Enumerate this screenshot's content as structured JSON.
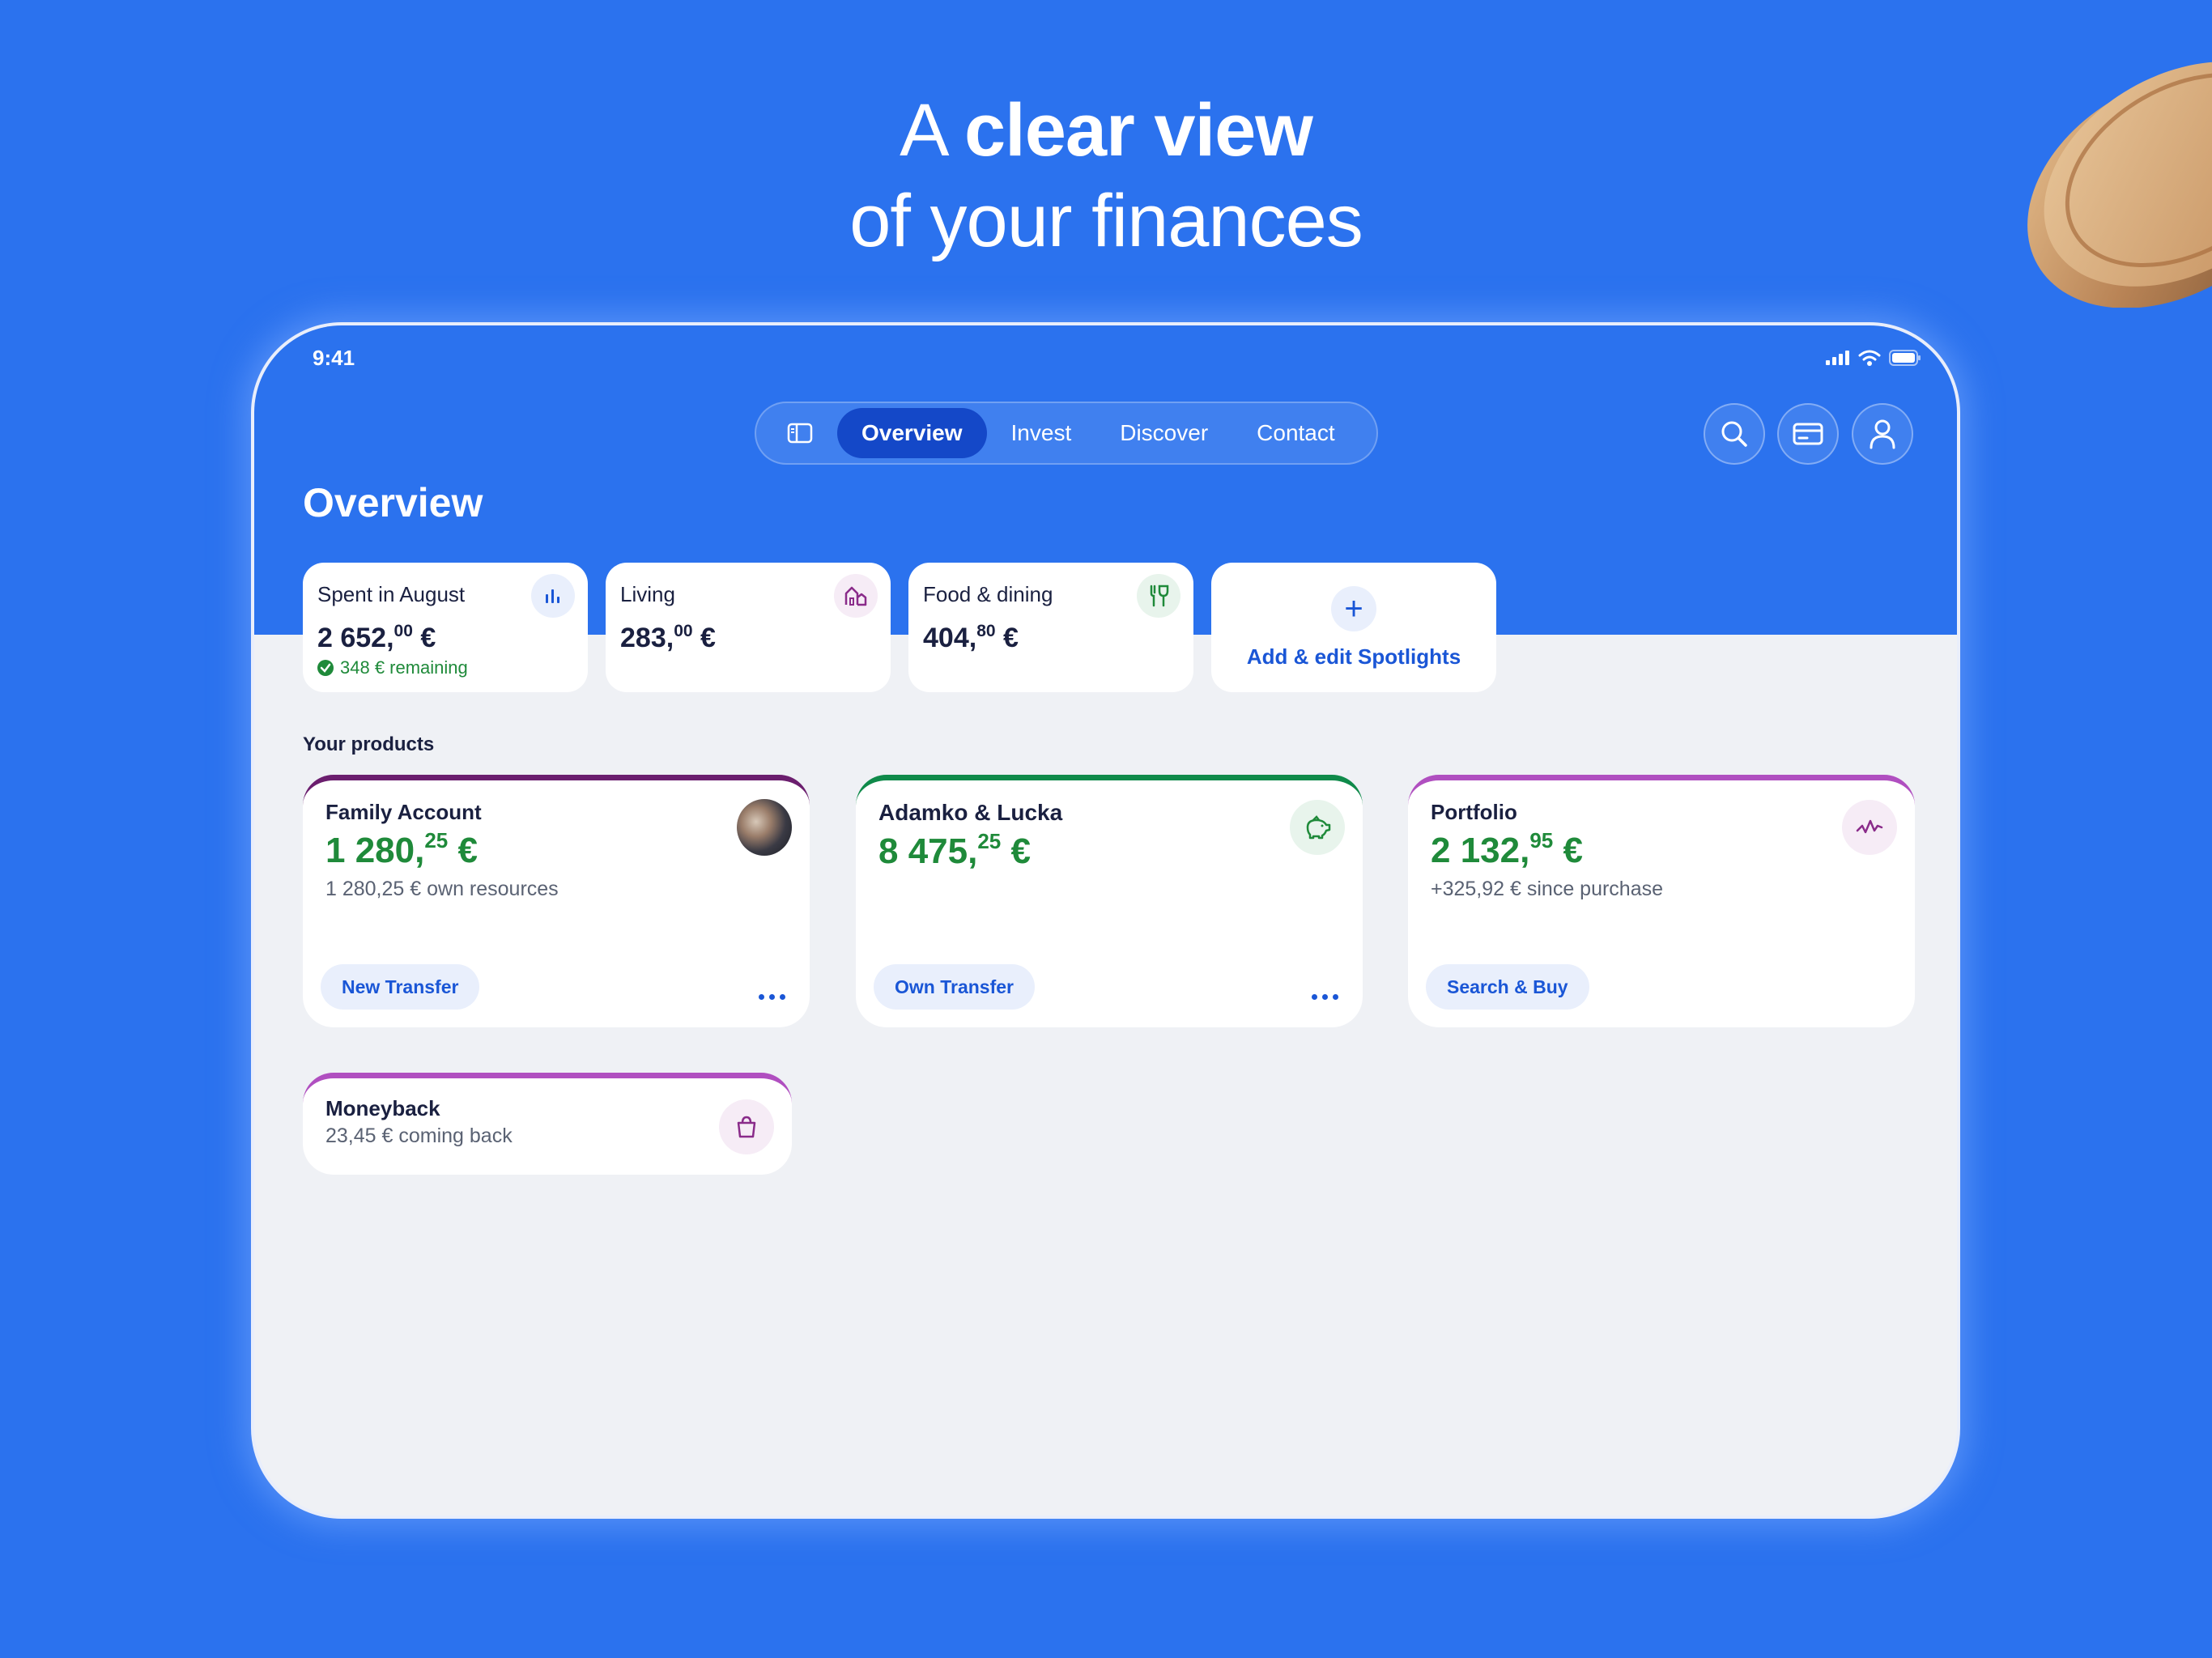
{
  "headline": {
    "line1_prefix": "A ",
    "line1_bold": "clear view",
    "line2": "of your finances"
  },
  "status_bar": {
    "time": "9:41"
  },
  "nav": {
    "tabs": [
      {
        "label": "Overview",
        "active": true
      },
      {
        "label": "Invest",
        "active": false
      },
      {
        "label": "Discover",
        "active": false
      },
      {
        "label": "Contact",
        "active": false
      }
    ]
  },
  "page_title": "Overview",
  "spotlights": [
    {
      "label": "Spent in August",
      "value_int": "2 652,",
      "value_dec": "00",
      "currency": " €",
      "remaining": "348 € remaining",
      "icon": "bar-chart-icon",
      "icon_color": "#1a56d6"
    },
    {
      "label": "Living",
      "value_int": "283,",
      "value_dec": "00",
      "currency": " €",
      "icon": "house-icon",
      "icon_color": "#8a2b8a"
    },
    {
      "label": "Food & dining",
      "value_int": "404,",
      "value_dec": "80",
      "currency": " €",
      "icon": "cutlery-icon",
      "icon_color": "#1f8a3a"
    }
  ],
  "add_spotlights_label": "Add & edit Spotlights",
  "products_section_label": "Your products",
  "products": [
    {
      "title": "Family Account",
      "amount_int": "1 280,",
      "amount_dec": "25",
      "currency": " €",
      "sub": "1 280,25 € own resources",
      "action": "New Transfer",
      "accent": "#6b1e6e"
    },
    {
      "title": "Adamko & Lucka",
      "amount_int": "8 475,",
      "amount_dec": "25",
      "currency": " €",
      "sub": "",
      "action": "Own Transfer",
      "accent": "#0f8a4a",
      "icon": "piggy-bank-icon"
    },
    {
      "title": "Portfolio",
      "amount_int": "2 132,",
      "amount_dec": "95",
      "currency": " €",
      "sub": "+325,92 € since purchase",
      "action": "Search & Buy",
      "accent": "#b04fc0",
      "icon": "chart-line-icon"
    },
    {
      "title": "Moneyback",
      "sub": "23,45 € coming back",
      "accent": "#b04fc0",
      "icon": "shopping-bag-icon"
    }
  ],
  "colors": {
    "background": "#2b72ee",
    "nav_active": "#1448c8",
    "amount_green": "#1f8a3a",
    "link_blue": "#1a56d6"
  }
}
